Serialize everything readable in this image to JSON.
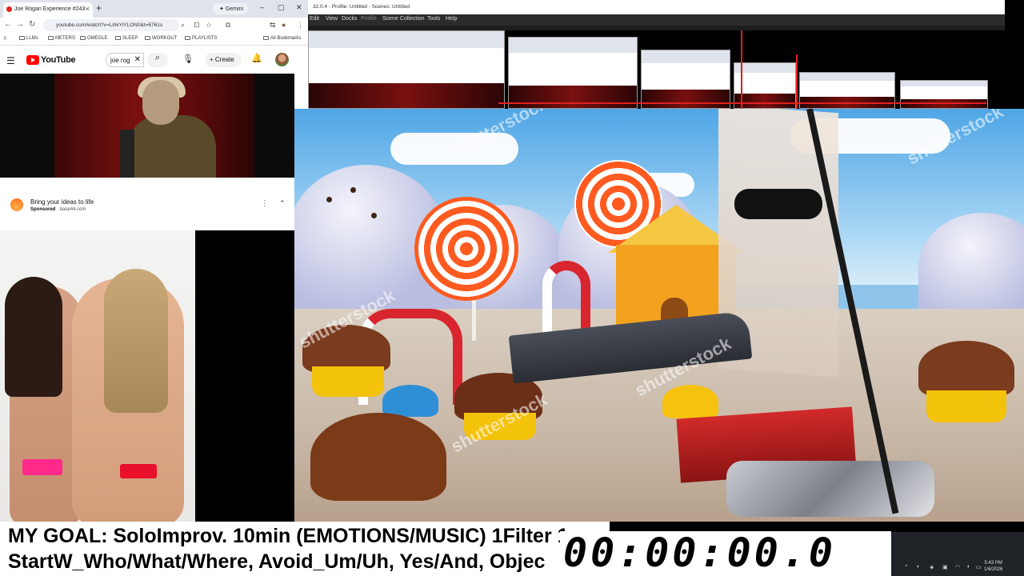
{
  "browser": {
    "tab_title": "Joe Rogan Experience #243",
    "gemini_tab": "Gemini",
    "url": "youtube.com/watch?v=LihkYiYLON0&t=6761s",
    "bookmarks": [
      "LLMs",
      "METERS",
      "OMEGLE",
      "SLEEP",
      "WORKOUT",
      "PLAYLISTS",
      "All Bookmarks"
    ]
  },
  "youtube": {
    "logo_text": "YouTube",
    "search_value": "joe rog",
    "create_label": "Create"
  },
  "sponsored": {
    "title": "Bring your ideas to life",
    "label": "Sponsored",
    "domain": "base44.com"
  },
  "obs": {
    "title": "32.0.4 - Profile: Untitled - Scenes: Untitled",
    "menu": [
      "Edit",
      "View",
      "Docks",
      "Profile",
      "Scene Collection",
      "Tools",
      "Help"
    ]
  },
  "scene": {
    "watermarks": [
      "shutterstock",
      "shutterstock",
      "shutterstock",
      "shutterstock",
      "shutterstock"
    ]
  },
  "ticker": {
    "line1": "MY GOAL: SoloImprov. 10min (EMOTIONS/MUSIC) 1Filter 1",
    "line2": "StartW_Who/What/Where, Avoid_Um/Uh, Yes/And, Objec",
    "timer": "00:00:00.0"
  },
  "taskbar": {
    "time": "5:43 PM",
    "date": "1/6/2026"
  },
  "colors": {
    "youtube_red": "#ff0000",
    "obs_dark": "#1e1e1e",
    "recursion_red": "#e02020"
  }
}
